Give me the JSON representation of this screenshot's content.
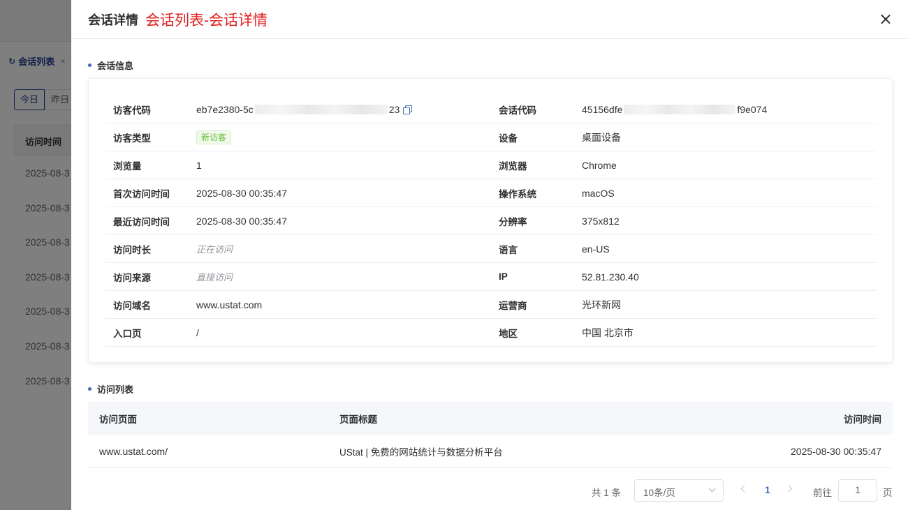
{
  "background": {
    "tab_label": "会话列表",
    "tab_close": "×",
    "filter_buttons": [
      "今日",
      "昨日"
    ],
    "table_header": "访问时间",
    "rows": [
      "2025-08-3",
      "2025-08-3",
      "2025-08-3",
      "2025-08-3",
      "2025-08-3",
      "2025-08-3",
      "2025-08-3"
    ]
  },
  "drawer": {
    "title": "会话详情",
    "subtitle": "会话列表-会话详情",
    "session_section_title": "会话信息",
    "visit_section_title": "访问列表",
    "info_rows": [
      {
        "left_label": "访客代码",
        "left_value_start": "eb7e2380-5c",
        "left_value_end": "23",
        "right_label": "会话代码",
        "right_value_start": "45156dfe",
        "right_value_end": "f9e074"
      },
      {
        "left_label": "访客类型",
        "left_tag": "新访客",
        "right_label": "设备",
        "right_value": "桌面设备"
      },
      {
        "left_label": "浏览量",
        "left_value": "1",
        "right_label": "浏览器",
        "right_value": "Chrome"
      },
      {
        "left_label": "首次访问时间",
        "left_value": "2025-08-30 00:35:47",
        "right_label": "操作系统",
        "right_value": "macOS"
      },
      {
        "left_label": "最近访问时间",
        "left_value": "2025-08-30 00:35:47",
        "right_label": "分辨率",
        "right_value": "375x812"
      },
      {
        "left_label": "访问时长",
        "left_value": "正在访问",
        "right_label": "语言",
        "right_value": "en-US"
      },
      {
        "left_label": "访问来源",
        "left_value": "直接访问",
        "right_label": "IP",
        "right_value": "52.81.230.40"
      },
      {
        "left_label": "访问域名",
        "left_value": "www.ustat.com",
        "right_label": "运营商",
        "right_value": "光环新网"
      },
      {
        "left_label": "入口页",
        "left_value": "/",
        "right_label": "地区",
        "right_value": "中国 北京市"
      }
    ],
    "visit_table": {
      "headers": [
        "访问页面",
        "页面标题",
        "访问时间"
      ],
      "rows": [
        [
          "www.ustat.com/",
          "UStat | 免费的网站统计与数据分析平台",
          "2025-08-30 00:35:47"
        ]
      ]
    },
    "pagination": {
      "total": "共 1 条",
      "page_size": "10条/页",
      "current_page": "1",
      "goto_label": "前往",
      "goto_value": "1",
      "page_suffix": "页"
    }
  },
  "colors": {
    "accent": "#3e6ab4",
    "subtitle_red": "#e02020",
    "tag_green": "#67c23a"
  }
}
